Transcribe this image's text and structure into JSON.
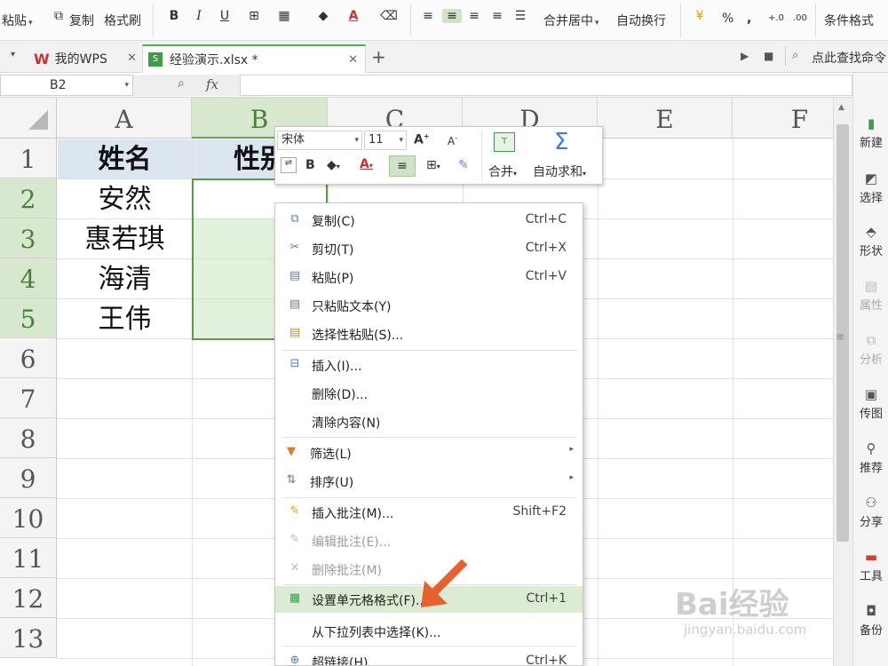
{
  "ribbon": {
    "paste": "粘贴",
    "copy": "复制",
    "format_painter": "格式刷",
    "merge_center": "合并居中",
    "wrap_text": "自动换行",
    "percent": "%",
    "comma": ",",
    "dec_inc": "+.0",
    "dec_dec": ".00",
    "cond_format": "条件格式"
  },
  "tabs": [
    {
      "label": "我的WPS"
    },
    {
      "label": "经验演示.xlsx *"
    }
  ],
  "tabbar_search": "点此查找命令",
  "namebox": "B2",
  "fx": "fx",
  "columns": [
    "A",
    "B",
    "C",
    "D",
    "E",
    "F"
  ],
  "rows": [
    "1",
    "2",
    "3",
    "4",
    "5",
    "6",
    "7",
    "8",
    "9",
    "10",
    "11",
    "12",
    "13"
  ],
  "cells": {
    "A1": "姓名",
    "B1": "性别",
    "A2": "安然",
    "A3": "惠若琪",
    "A4": "海清",
    "A5": "王伟"
  },
  "mini_toolbar": {
    "font": "宋体",
    "size": "11",
    "merge": "合并",
    "autosum": "自动求和"
  },
  "menu": [
    {
      "label": "复制(C)",
      "shortcut": "Ctrl+C",
      "icon": "copy-icon"
    },
    {
      "label": "剪切(T)",
      "shortcut": "Ctrl+X",
      "icon": "scissors-icon"
    },
    {
      "label": "粘贴(P)",
      "shortcut": "Ctrl+V",
      "icon": "paste-icon"
    },
    {
      "label": "只粘贴文本(Y)",
      "shortcut": "",
      "icon": "paste-text-icon"
    },
    {
      "label": "选择性粘贴(S)...",
      "shortcut": "",
      "icon": "paste-special-icon"
    },
    {
      "label": "插入(I)...",
      "shortcut": "",
      "icon": "insert-icon"
    },
    {
      "label": "删除(D)...",
      "shortcut": ""
    },
    {
      "label": "清除内容(N)",
      "shortcut": ""
    },
    {
      "label": "筛选(L)",
      "shortcut": "",
      "icon": "filter-icon",
      "submenu": true
    },
    {
      "label": "排序(U)",
      "shortcut": "",
      "icon": "sort-icon",
      "submenu": true
    },
    {
      "label": "插入批注(M)...",
      "shortcut": "Shift+F2",
      "icon": "comment-add-icon"
    },
    {
      "label": "编辑批注(E)...",
      "shortcut": "",
      "icon": "comment-edit-icon",
      "disabled": true
    },
    {
      "label": "删除批注(M)",
      "shortcut": "",
      "icon": "comment-delete-icon",
      "disabled": true
    },
    {
      "label": "设置单元格格式(F)...",
      "shortcut": "Ctrl+1",
      "icon": "format-cells-icon",
      "highlighted": true
    },
    {
      "label": "从下拉列表中选择(K)...",
      "shortcut": ""
    },
    {
      "label": "超链接(H)...",
      "shortcut": "Ctrl+K",
      "icon": "hyperlink-icon"
    }
  ],
  "sidepanel": [
    {
      "label": "新建",
      "icon": "new-icon"
    },
    {
      "label": "选择",
      "icon": "select-icon"
    },
    {
      "label": "形状",
      "icon": "shape-icon"
    },
    {
      "label": "属性",
      "icon": "property-icon",
      "dim": true
    },
    {
      "label": "分析",
      "icon": "analysis-icon",
      "dim": true
    },
    {
      "label": "传图",
      "icon": "upload-image-icon"
    },
    {
      "label": "推荐",
      "icon": "recommend-icon"
    },
    {
      "label": "分享",
      "icon": "share-icon"
    },
    {
      "label": "工具",
      "icon": "toolbox-icon"
    },
    {
      "label": "备份",
      "icon": "backup-icon"
    }
  ],
  "watermark": {
    "line1": "Bai经验",
    "line2": "jingyan.baidu.com"
  },
  "colors": {
    "selection": "#5b9b48",
    "accent": "#4caf50",
    "highlight": "#eef04a",
    "arrow": "#e8612c",
    "header_cell": "#dce6f1"
  }
}
